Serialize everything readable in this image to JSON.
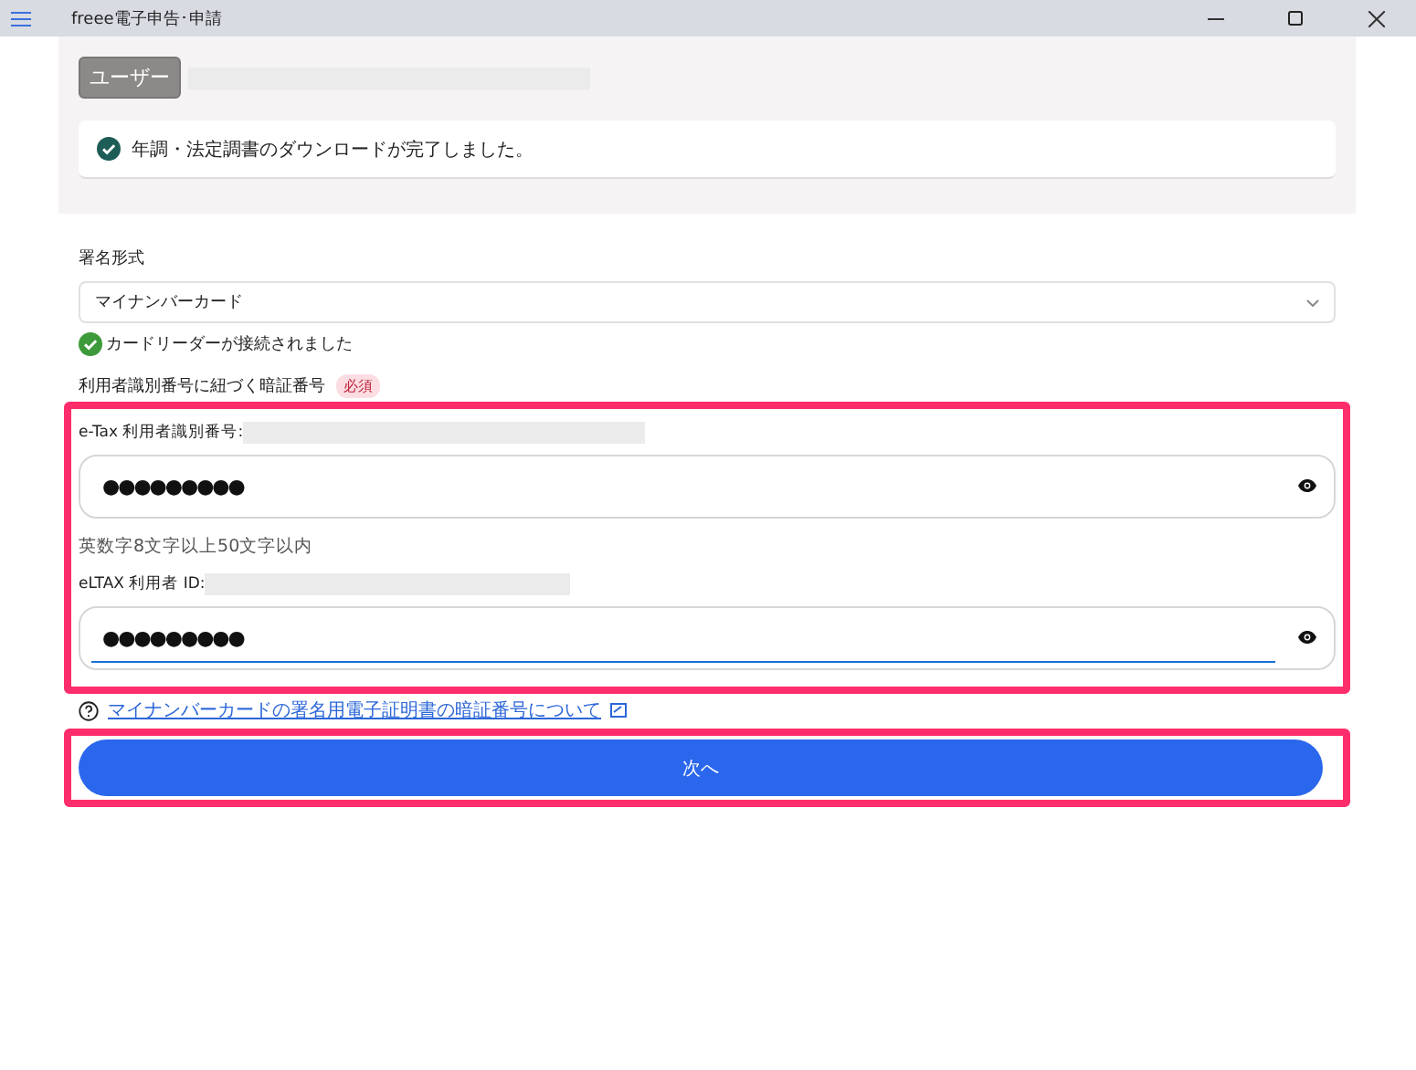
{
  "window": {
    "title": "freee電子申告･申請"
  },
  "user": {
    "badge": "ユーザー"
  },
  "notice": {
    "text": "年調・法定調書のダウンロードが完了しました。"
  },
  "signature": {
    "label": "署名形式",
    "value": "マイナンバーカード",
    "status": "カードリーダーが接続されました"
  },
  "pin_section": {
    "label": "利用者識別番号に紐づく暗証番号",
    "required": "必須"
  },
  "fields": [
    {
      "label": "e-Tax 利用者識別番号:",
      "value": "●●●●●●●●●",
      "hint": "英数字8文字以上50文字以内",
      "focused": false
    },
    {
      "label": "eLTAX 利用者 ID:",
      "value": "●●●●●●●●●",
      "focused": true
    }
  ],
  "help_link": "マイナンバーカードの署名用電子証明書の暗証番号について",
  "next_button": "次へ"
}
